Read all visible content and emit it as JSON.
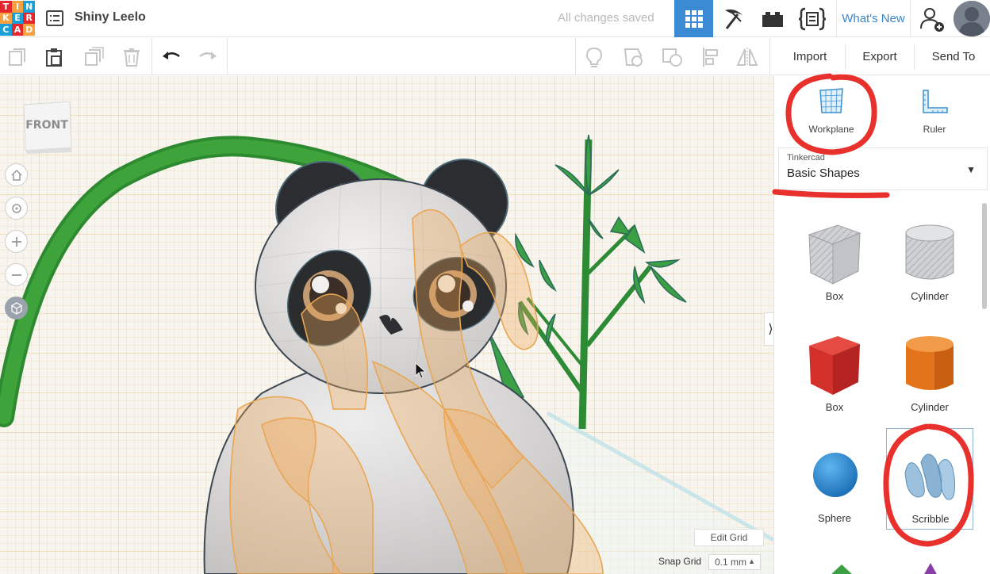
{
  "app": {
    "logo_letters": [
      "T",
      "I",
      "N",
      "K",
      "E",
      "R",
      "C",
      "A",
      "D"
    ],
    "logo_colors": [
      "#e5272d",
      "#f6a13d",
      "#1aa0d8",
      "#f6a13d",
      "#1aa0d8",
      "#e5272d",
      "#1aa0d8",
      "#e5272d",
      "#f6a13d"
    ],
    "design_title": "Shiny Leelo",
    "save_status": "All changes saved",
    "whats_new": "What's New",
    "accent_color": "#3b8ad4"
  },
  "topbar_icons": [
    "3d-design-grid-icon",
    "pickaxe-icon",
    "bricks-icon",
    "codeblocks-icon",
    "add-user-icon",
    "avatar"
  ],
  "toolbar": {
    "import_label": "Import",
    "export_label": "Export",
    "send_to_label": "Send To",
    "left_tools": [
      "copy-icon",
      "paste-icon",
      "duplicate-icon",
      "delete-icon",
      "undo-icon",
      "redo-icon"
    ],
    "right_tools": [
      "light-bulb-icon",
      "group-icon",
      "ungroup-icon",
      "align-icon",
      "mirror-icon"
    ]
  },
  "viewport": {
    "viewcube_label": "FRONT",
    "nav_buttons": [
      "home-view-icon",
      "fit-view-icon",
      "zoom-in-icon",
      "zoom-out-icon",
      "ortho-view-icon"
    ],
    "edit_grid_label": "Edit Grid",
    "snap_grid_label": "Snap Grid",
    "snap_grid_value": "0.1 mm"
  },
  "panel": {
    "workplane_label": "Workplane",
    "ruler_label": "Ruler",
    "library_source": "Tinkercad",
    "library_name": "Basic Shapes",
    "shapes": [
      {
        "label": "Box",
        "style": "hole"
      },
      {
        "label": "Cylinder",
        "style": "hole"
      },
      {
        "label": "Box",
        "style": "solid",
        "color": "#d8322b"
      },
      {
        "label": "Cylinder",
        "style": "solid",
        "color": "#e8781e"
      },
      {
        "label": "Sphere",
        "style": "solid",
        "color": "#2f8fd6"
      },
      {
        "label": "Scribble",
        "style": "solid",
        "color": "#8ab3d3"
      }
    ]
  },
  "annotations": {
    "color": "#e8302c"
  }
}
